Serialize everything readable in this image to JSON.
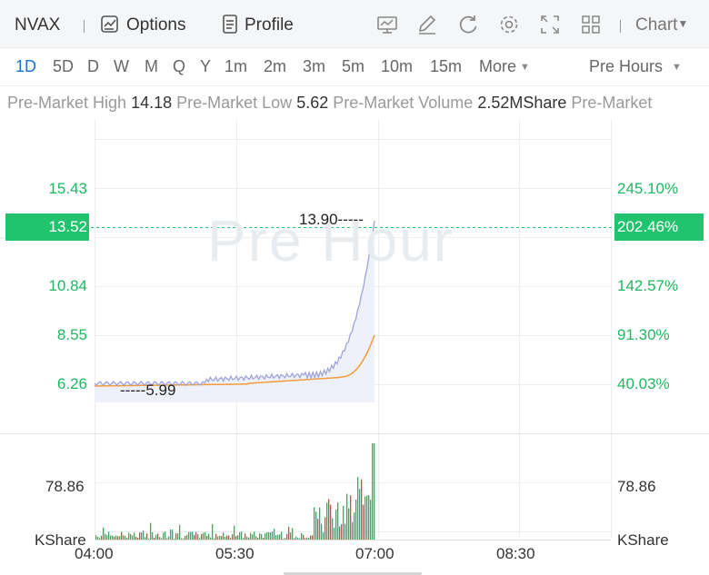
{
  "toolbar": {
    "symbol": "NVAX",
    "options_label": "Options",
    "profile_label": "Profile",
    "chart_menu_label": "Chart",
    "icons": [
      "chart-options-icon",
      "profile-doc-icon",
      "indicator-icon",
      "draw-icon",
      "refresh-icon",
      "settings-icon",
      "fullscreen-icon",
      "layout-grid-icon",
      "caret-down-icon"
    ]
  },
  "periods": {
    "items": [
      "1D",
      "5D",
      "D",
      "W",
      "M",
      "Q",
      "Y",
      "1m",
      "2m",
      "3m",
      "5m",
      "10m",
      "15m"
    ],
    "active": "1D",
    "more_label": "More",
    "session_label": "Pre Hours"
  },
  "info": {
    "high_label": "Pre-Market High",
    "high_value": "14.18",
    "low_label": "Pre-Market Low",
    "low_value": "5.62",
    "volume_label": "Pre-Market Volume",
    "volume_value": "2.52MShare",
    "trailing_label": "Pre-Market"
  },
  "chart": {
    "watermark": "Pre Hour",
    "price_axis_left": [
      "15.43",
      "10.84",
      "8.55",
      "6.26"
    ],
    "price_axis_right": [
      "245.10%",
      "142.57%",
      "91.30%",
      "40.03%"
    ],
    "current_price": "13.52",
    "current_pct": "202.46%",
    "high_annotation": "13.90",
    "low_annotation": "5.99",
    "volume_axis_value": "78.86",
    "volume_unit": "KShare",
    "time_labels": [
      "04:00",
      "05:30",
      "07:00",
      "08:30"
    ],
    "colors": {
      "price_line": "#9ea3dc",
      "avg_line": "#f39c3c",
      "axis_green": "#1db95f",
      "tag_green": "#22c36f",
      "vol_up": "#1db95f",
      "vol_down": "#e0433b",
      "active_blue": "#1e6fd9"
    }
  }
}
